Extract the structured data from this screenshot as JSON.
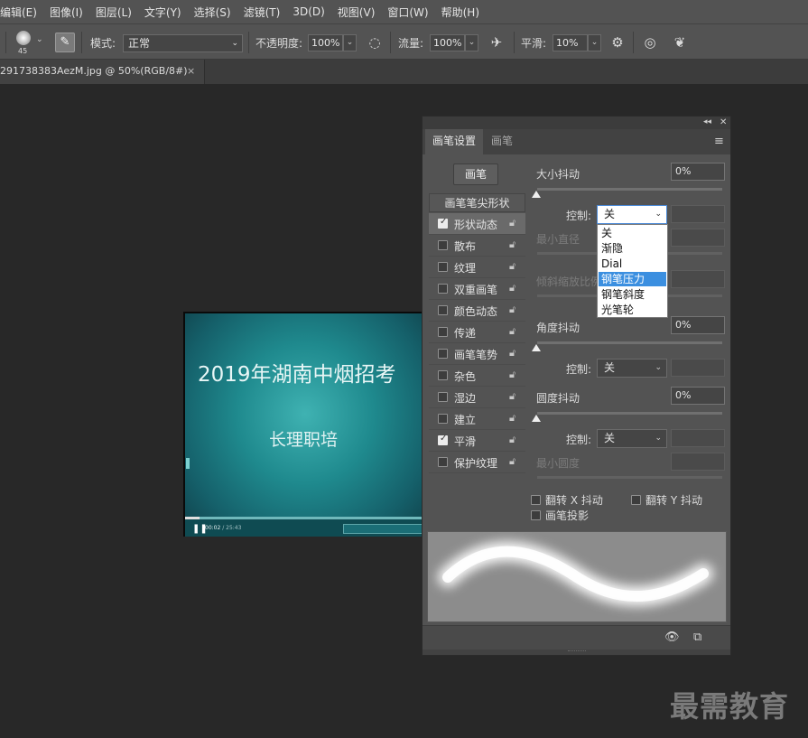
{
  "menu": [
    "编辑(E)",
    "图像(I)",
    "图层(L)",
    "文字(Y)",
    "选择(S)",
    "滤镜(T)",
    "3D(D)",
    "视图(V)",
    "窗口(W)",
    "帮助(H)"
  ],
  "options": {
    "brush_size": "45",
    "mode_label": "模式:",
    "mode_value": "正常",
    "opacity_label": "不透明度:",
    "opacity_value": "100%",
    "flow_label": "流量:",
    "flow_value": "100%",
    "smooth_label": "平滑:",
    "smooth_value": "10%"
  },
  "document_tab": {
    "title": "291738383AezM.jpg @ 50%(RGB/8#)",
    "close": "×"
  },
  "image": {
    "title": "2019年湖南中烟招考",
    "subtitle": "长理职培",
    "time_current": "00:02",
    "time_total": "/ 25:43",
    "progress": 0.06
  },
  "panel": {
    "tab_active": "画笔设置",
    "tab_inactive": "画笔",
    "brush_button": "画笔",
    "list_header": "画笔笔尖形状",
    "options": [
      {
        "label": "形状动态",
        "checked": true,
        "selected": true
      },
      {
        "label": "散布",
        "checked": false,
        "selected": false
      },
      {
        "label": "纹理",
        "checked": false,
        "selected": false
      },
      {
        "label": "双重画笔",
        "checked": false,
        "selected": false
      },
      {
        "label": "颜色动态",
        "checked": false,
        "selected": false
      },
      {
        "label": "传递",
        "checked": false,
        "selected": false
      },
      {
        "label": "画笔笔势",
        "checked": false,
        "selected": false
      },
      {
        "label": "杂色",
        "checked": false,
        "selected": false
      },
      {
        "label": "湿边",
        "checked": false,
        "selected": false
      },
      {
        "label": "建立",
        "checked": false,
        "selected": false
      },
      {
        "label": "平滑",
        "checked": true,
        "selected": false
      },
      {
        "label": "保护纹理",
        "checked": false,
        "selected": false
      }
    ],
    "size_jitter_label": "大小抖动",
    "size_jitter_value": "0%",
    "control_label": "控制:",
    "control_size_value": "关",
    "min_diameter_label": "最小直径",
    "tilt_scale_label": "倾斜缩放比例",
    "angle_jitter_label": "角度抖动",
    "angle_jitter_value": "0%",
    "control_angle_value": "关",
    "roundness_jitter_label": "圆度抖动",
    "roundness_jitter_value": "0%",
    "control_roundness_value": "关",
    "min_roundness_label": "最小圆度",
    "flip_x_label": "翻转 X 抖动",
    "flip_y_label": "翻转 Y 抖动",
    "brush_projection_label": "画笔投影",
    "dropdown_options": [
      "关",
      "渐隐",
      "Dial",
      "钢笔压力",
      "钢笔斜度",
      "光笔轮"
    ],
    "dropdown_highlighted": "钢笔压力"
  },
  "watermark": "最需教育"
}
